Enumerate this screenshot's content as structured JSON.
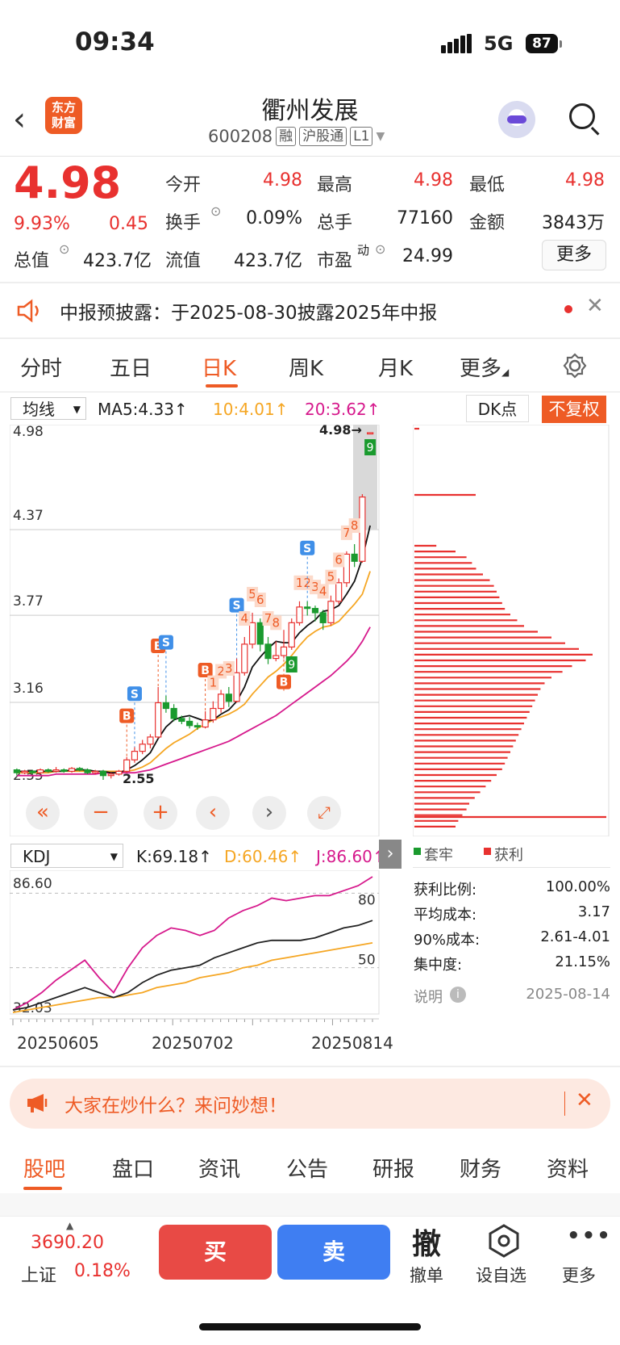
{
  "status": {
    "time": "09:34",
    "network": "5G",
    "battery": "87"
  },
  "header": {
    "logo_line1": "东方",
    "logo_line2": "财富",
    "name": "衢州发展",
    "code": "600208",
    "tags": [
      "融",
      "沪股通",
      "L1"
    ]
  },
  "quote": {
    "price": "4.98",
    "pct": "9.93%",
    "change": "0.45",
    "fields": [
      {
        "label": "今开",
        "value": "4.98",
        "color": "#e8312f"
      },
      {
        "label": "最高",
        "value": "4.98",
        "color": "#e8312f"
      },
      {
        "label": "最低",
        "value": "4.98",
        "color": "#e8312f"
      },
      {
        "label": "换手",
        "value": "0.09%",
        "color": "#222"
      },
      {
        "label": "总手",
        "value": "77160",
        "color": "#222"
      },
      {
        "label": "金额",
        "value": "3843万",
        "color": "#222"
      },
      {
        "label": "总值",
        "value": "423.7亿",
        "color": "#222"
      },
      {
        "label": "流值",
        "value": "423.7亿",
        "color": "#222"
      },
      {
        "label": "市盈",
        "label_sup": "动",
        "value": "24.99",
        "color": "#222"
      }
    ],
    "more_label": "更多"
  },
  "notice": {
    "text": "中报预披露：于2025-08-30披露2025年中报"
  },
  "tabs": [
    "分时",
    "五日",
    "日K",
    "周K",
    "月K",
    "更多"
  ],
  "active_tab": "日K",
  "ma_row": {
    "selector": "均线",
    "ma5": "MA5:4.33↑",
    "ma10": "10:4.01↑",
    "ma20": "20:3.62↑",
    "dk_label": "DK点",
    "fq_label": "不复权",
    "ma10_color": "#f5a623",
    "ma20_color": "#d6198c"
  },
  "kline": {
    "price_labels": [
      "4.98",
      "4.37",
      "3.77",
      "3.16",
      "2.55"
    ],
    "max_marker": "4.98→",
    "min_marker": "2.55",
    "candles": [
      {
        "o": 2.62,
        "c": 2.6,
        "h": 2.63,
        "l": 2.58
      },
      {
        "o": 2.6,
        "c": 2.61,
        "h": 2.62,
        "l": 2.59
      },
      {
        "o": 2.61,
        "c": 2.6,
        "h": 2.62,
        "l": 2.59
      },
      {
        "o": 2.6,
        "c": 2.62,
        "h": 2.63,
        "l": 2.59
      },
      {
        "o": 2.62,
        "c": 2.61,
        "h": 2.63,
        "l": 2.6
      },
      {
        "o": 2.61,
        "c": 2.62,
        "h": 2.64,
        "l": 2.6
      },
      {
        "o": 2.62,
        "c": 2.61,
        "h": 2.63,
        "l": 2.6
      },
      {
        "o": 2.61,
        "c": 2.63,
        "h": 2.64,
        "l": 2.6
      },
      {
        "o": 2.63,
        "c": 2.62,
        "h": 2.64,
        "l": 2.61
      },
      {
        "o": 2.62,
        "c": 2.6,
        "h": 2.63,
        "l": 2.59
      },
      {
        "o": 2.6,
        "c": 2.61,
        "h": 2.62,
        "l": 2.59
      },
      {
        "o": 2.61,
        "c": 2.58,
        "h": 2.62,
        "l": 2.55
      },
      {
        "o": 2.58,
        "c": 2.59,
        "h": 2.6,
        "l": 2.56
      },
      {
        "o": 2.59,
        "c": 2.61,
        "h": 2.62,
        "l": 2.58
      },
      {
        "o": 2.61,
        "c": 2.69,
        "h": 2.71,
        "l": 2.6
      },
      {
        "o": 2.69,
        "c": 2.75,
        "h": 2.78,
        "l": 2.67
      },
      {
        "o": 2.75,
        "c": 2.8,
        "h": 2.83,
        "l": 2.73
      },
      {
        "o": 2.8,
        "c": 2.85,
        "h": 2.87,
        "l": 2.77
      },
      {
        "o": 2.85,
        "c": 3.09,
        "h": 3.2,
        "l": 2.84
      },
      {
        "o": 3.09,
        "c": 3.05,
        "h": 3.14,
        "l": 3.02
      },
      {
        "o": 3.05,
        "c": 2.98,
        "h": 3.08,
        "l": 2.96
      },
      {
        "o": 2.98,
        "c": 2.96,
        "h": 3.0,
        "l": 2.94
      },
      {
        "o": 2.96,
        "c": 2.93,
        "h": 2.99,
        "l": 2.91
      },
      {
        "o": 2.93,
        "c": 2.92,
        "h": 2.95,
        "l": 2.9
      },
      {
        "o": 2.92,
        "c": 2.97,
        "h": 3.03,
        "l": 2.91
      },
      {
        "o": 2.97,
        "c": 3.05,
        "h": 3.1,
        "l": 2.95
      },
      {
        "o": 3.05,
        "c": 3.15,
        "h": 3.18,
        "l": 3.02
      },
      {
        "o": 3.15,
        "c": 3.1,
        "h": 3.2,
        "l": 3.06
      },
      {
        "o": 3.1,
        "c": 3.3,
        "h": 3.4,
        "l": 3.09
      },
      {
        "o": 3.3,
        "c": 3.5,
        "h": 3.55,
        "l": 3.28
      },
      {
        "o": 3.5,
        "c": 3.65,
        "h": 3.72,
        "l": 3.47
      },
      {
        "o": 3.65,
        "c": 3.5,
        "h": 3.68,
        "l": 3.45
      },
      {
        "o": 3.5,
        "c": 3.4,
        "h": 3.55,
        "l": 3.36
      },
      {
        "o": 3.4,
        "c": 3.42,
        "h": 3.52,
        "l": 3.38
      },
      {
        "o": 3.42,
        "c": 3.48,
        "h": 3.6,
        "l": 3.4
      },
      {
        "o": 3.48,
        "c": 3.65,
        "h": 3.68,
        "l": 3.46
      },
      {
        "o": 3.65,
        "c": 3.76,
        "h": 3.8,
        "l": 3.63
      },
      {
        "o": 3.76,
        "c": 3.75,
        "h": 3.8,
        "l": 3.7
      },
      {
        "o": 3.75,
        "c": 3.72,
        "h": 3.77,
        "l": 3.66
      },
      {
        "o": 3.72,
        "c": 3.65,
        "h": 3.74,
        "l": 3.6
      },
      {
        "o": 3.65,
        "c": 3.8,
        "h": 3.84,
        "l": 3.63
      },
      {
        "o": 3.8,
        "c": 3.93,
        "h": 3.96,
        "l": 3.78
      },
      {
        "o": 3.93,
        "c": 4.13,
        "h": 4.15,
        "l": 3.9
      },
      {
        "o": 4.13,
        "c": 4.08,
        "h": 4.2,
        "l": 4.04
      },
      {
        "o": 4.08,
        "c": 4.53,
        "h": 4.55,
        "l": 4.07
      },
      {
        "o": 4.98,
        "c": 4.98,
        "h": 4.98,
        "l": 4.98
      }
    ],
    "ma5": [
      2.61,
      2.61,
      2.61,
      2.61,
      2.61,
      2.61,
      2.61,
      2.62,
      2.62,
      2.62,
      2.61,
      2.61,
      2.6,
      2.6,
      2.62,
      2.65,
      2.69,
      2.74,
      2.84,
      2.92,
      2.97,
      2.99,
      3.0,
      2.98,
      2.96,
      2.97,
      3.01,
      3.04,
      3.1,
      3.2,
      3.34,
      3.41,
      3.47,
      3.52,
      3.51,
      3.51,
      3.58,
      3.63,
      3.67,
      3.73,
      3.74,
      3.77,
      3.85,
      3.94,
      4.1,
      4.33
    ],
    "ma10": [
      2.6,
      2.6,
      2.6,
      2.6,
      2.6,
      2.61,
      2.61,
      2.61,
      2.61,
      2.61,
      2.61,
      2.61,
      2.61,
      2.61,
      2.61,
      2.62,
      2.64,
      2.67,
      2.72,
      2.77,
      2.81,
      2.84,
      2.87,
      2.91,
      2.94,
      2.97,
      2.99,
      3.01,
      3.04,
      3.08,
      3.15,
      3.21,
      3.27,
      3.31,
      3.36,
      3.42,
      3.49,
      3.55,
      3.59,
      3.62,
      3.63,
      3.66,
      3.72,
      3.78,
      3.85,
      4.01
    ],
    "ma20": [
      2.58,
      2.58,
      2.58,
      2.58,
      2.58,
      2.59,
      2.59,
      2.59,
      2.59,
      2.59,
      2.59,
      2.6,
      2.6,
      2.6,
      2.6,
      2.6,
      2.61,
      2.62,
      2.64,
      2.66,
      2.68,
      2.7,
      2.72,
      2.74,
      2.76,
      2.78,
      2.8,
      2.82,
      2.85,
      2.88,
      2.91,
      2.94,
      2.97,
      3.0,
      3.04,
      3.08,
      3.12,
      3.16,
      3.2,
      3.24,
      3.28,
      3.33,
      3.38,
      3.44,
      3.52,
      3.62
    ],
    "markers": [
      {
        "t": "B",
        "i": 14,
        "up": true
      },
      {
        "t": "S",
        "i": 15,
        "up": true
      },
      {
        "t": "B",
        "i": 18,
        "up": true
      },
      {
        "t": "S",
        "i": 19,
        "up": true
      },
      {
        "t": "B",
        "i": 24,
        "up": true
      },
      {
        "t": "1",
        "i": 25,
        "up": true
      },
      {
        "t": "2",
        "i": 26,
        "up": true
      },
      {
        "t": "3",
        "i": 27,
        "up": true
      },
      {
        "t": "S",
        "i": 28,
        "up": true
      },
      {
        "t": "4",
        "i": 29,
        "up": true
      },
      {
        "t": "5",
        "i": 30,
        "up": true
      },
      {
        "t": "6",
        "i": 31,
        "up": true
      },
      {
        "t": "7",
        "i": 32,
        "up": true
      },
      {
        "t": "8",
        "i": 33,
        "up": true
      },
      {
        "t": "B",
        "i": 34,
        "up": false
      },
      {
        "t": "9",
        "i": 35,
        "up": false
      },
      {
        "t": "1",
        "i": 36,
        "up": true
      },
      {
        "t": "2",
        "i": 37,
        "up": true
      },
      {
        "t": "S",
        "i": 37,
        "up": true
      },
      {
        "t": "3",
        "i": 38,
        "up": true
      },
      {
        "t": "4",
        "i": 39,
        "up": true
      },
      {
        "t": "5",
        "i": 40,
        "up": true
      },
      {
        "t": "6",
        "i": 41,
        "up": true
      },
      {
        "t": "7",
        "i": 42,
        "up": true
      },
      {
        "t": "8",
        "i": 43,
        "up": true
      },
      {
        "t": "9",
        "i": 45,
        "up": false
      }
    ]
  },
  "kdj": {
    "selector": "KDJ",
    "k": "K:69.18↑",
    "d": "D:60.46↑",
    "j": "J:86.60↑",
    "labels": [
      "86.60",
      "80",
      "50",
      "32.03"
    ],
    "k_series": [
      33,
      34,
      36,
      38,
      40,
      42,
      40,
      38,
      40,
      44,
      47,
      49,
      50,
      51,
      54,
      56,
      58,
      60,
      61,
      61,
      61,
      62,
      64,
      66,
      67,
      69
    ],
    "d_series": [
      32,
      33,
      34,
      35,
      36,
      37,
      38,
      38,
      39,
      40,
      42,
      43,
      44,
      46,
      47,
      48,
      50,
      51,
      53,
      54,
      55,
      56,
      57,
      58,
      59,
      60
    ],
    "j_series": [
      33,
      36,
      40,
      45,
      49,
      53,
      46,
      40,
      50,
      58,
      63,
      66,
      65,
      63,
      65,
      70,
      73,
      75,
      78,
      77,
      78,
      79,
      79,
      81,
      83,
      86.6
    ],
    "colors": {
      "k": "#222222",
      "d": "#f5a623",
      "j": "#d6198c"
    }
  },
  "dates": [
    "20250605",
    "20250702",
    "20250814"
  ],
  "chips": {
    "legend_trapped": "套牢",
    "legend_profit": "获利",
    "rows": [
      {
        "label": "获利比例:",
        "value": "100.00%"
      },
      {
        "label": "平均成本:",
        "value": "3.17"
      },
      {
        "label": "90%成本:",
        "value": "2.61-4.01"
      },
      {
        "label": "集中度:",
        "value": "21.15%"
      }
    ],
    "note_label": "说明",
    "date": "2025-08-14",
    "dist": [
      16,
      30,
      38,
      42,
      45,
      50,
      55,
      58,
      60,
      62,
      64,
      66,
      70,
      75,
      80,
      90,
      100,
      110,
      120,
      130,
      125,
      115,
      108,
      100,
      95,
      92,
      90,
      88,
      86,
      84,
      82,
      80,
      78,
      76,
      74,
      72,
      70,
      68,
      66,
      64,
      60,
      56,
      52,
      48,
      44,
      40,
      38,
      35,
      32,
      30
    ]
  },
  "banner": {
    "text": "大家在炒什么？来问妙想！"
  },
  "bottom_tabs": [
    "股吧",
    "盘口",
    "资讯",
    "公告",
    "研报",
    "财务",
    "资料"
  ],
  "bottom_bar": {
    "index_value": "3690.20",
    "index_name": "上证",
    "index_pct": "0.18%",
    "buy": "买",
    "sell": "卖",
    "cancel_glyph": "撤",
    "cancel": "撤单",
    "watch": "设自选",
    "more": "更多"
  }
}
